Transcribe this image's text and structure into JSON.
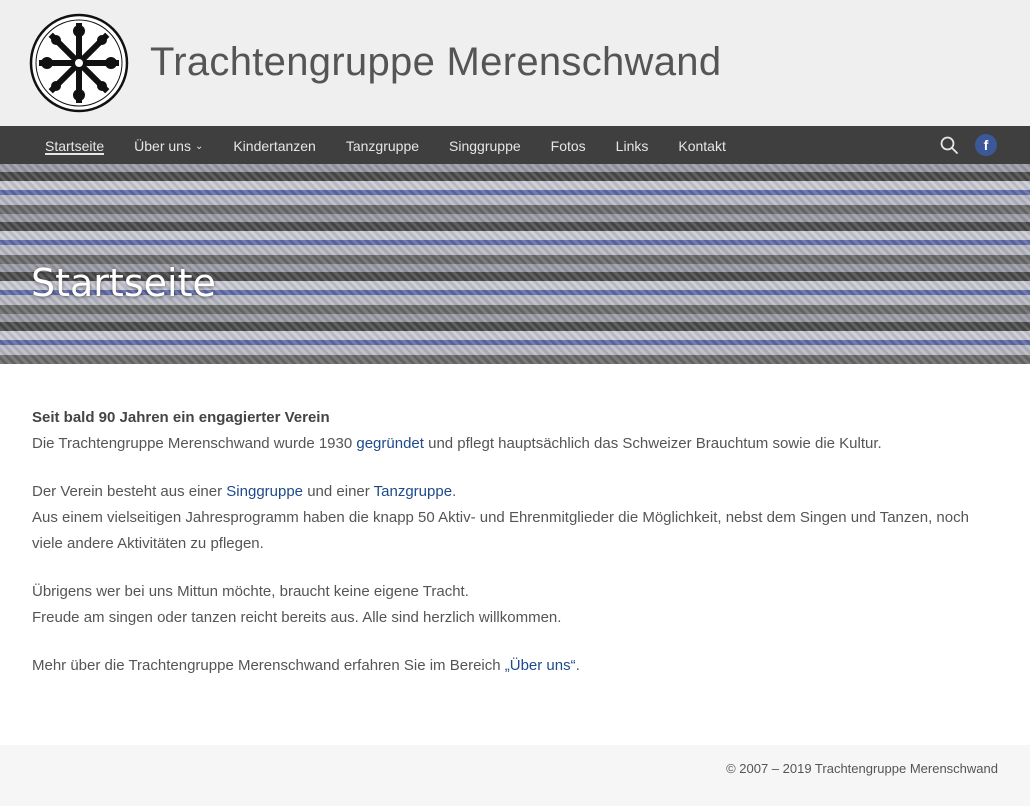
{
  "site": {
    "title": "Trachtengruppe Merenschwand"
  },
  "nav": {
    "items": [
      {
        "label": "Startseite"
      },
      {
        "label": "Über uns"
      },
      {
        "label": "Kindertanzen"
      },
      {
        "label": "Tanzgruppe"
      },
      {
        "label": "Singgruppe"
      },
      {
        "label": "Fotos"
      },
      {
        "label": "Links"
      },
      {
        "label": "Kontakt"
      }
    ],
    "search_icon": "search-icon",
    "facebook_icon": "facebook-icon",
    "facebook_glyph": "f"
  },
  "hero": {
    "title": "Startseite"
  },
  "content": {
    "heading": "Seit bald 90 Jahren ein engagierter Verein",
    "p1_a": "Die Trachtengruppe Merenschwand wurde 1930 ",
    "p1_link": "gegründet",
    "p1_b": " und pflegt hauptsächlich das Schweizer Brauchtum sowie die Kultur.",
    "p2_a": "Der Verein besteht aus einer ",
    "p2_link1": "Singgruppe",
    "p2_b": " und einer ",
    "p2_link2": "Tanzgruppe",
    "p2_c": ".",
    "p2_line2": "Aus einem vielseitigen Jahresprogramm haben die knapp 50 Aktiv- und Ehrenmitglieder die Möglichkeit, nebst dem Singen und Tanzen, noch viele andere Aktivitäten zu pflegen.",
    "p3_line1": "Übrigens wer bei uns Mittun möchte, braucht keine eigene Tracht.",
    "p3_line2": "Freude am singen oder tanzen reicht bereits aus. Alle sind herzlich willkommen.",
    "p4_a": "Mehr über die Trachtengruppe Merenschwand erfahren Sie im Bereich ",
    "p4_link": "„Über uns“",
    "p4_b": "."
  },
  "footer": {
    "copyright": "© 2007 – 2019 Trachtengruppe Merenschwand"
  },
  "colors": {
    "nav_bg": "#3f3f3f",
    "header_bg": "#efefef",
    "link": "#1e4a8a",
    "facebook": "#3b5998"
  }
}
